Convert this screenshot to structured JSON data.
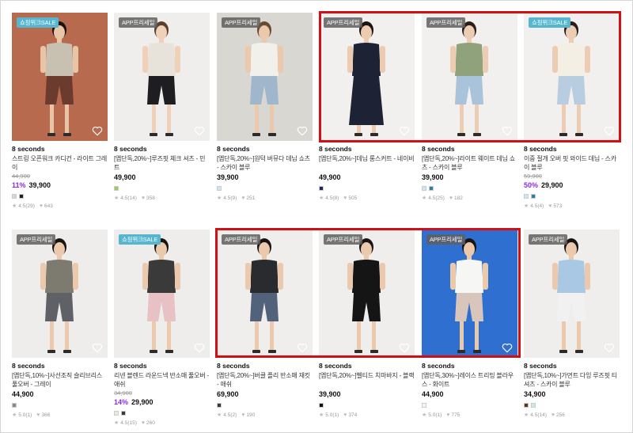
{
  "badges": {
    "sale": "쇼핑위크SALE",
    "app": "APP프리세일"
  },
  "products": [
    {
      "brand": "8 seconds",
      "name": "스트링 오픈워크 카디건 - 라이트 그레이",
      "orig": "44,900",
      "disc": "11%",
      "price": "39,900",
      "rating": "4.5(29)",
      "likes": "643",
      "badge": "sale",
      "swatches": [
        "#d8d5cf",
        "#222222"
      ]
    },
    {
      "brand": "8 seconds",
      "name": "[앱단독,20%~]루즈핏 체크 셔츠 - 민트",
      "orig": "",
      "disc": "",
      "price": "49,900",
      "rating": "4.5(14)",
      "likes": "358",
      "badge": "app",
      "swatches": [
        "#9acd5a"
      ]
    },
    {
      "brand": "8 seconds",
      "name": "[앱단독,20%~]원턱 버뮤다 데님 쇼츠 - 스카이 블루",
      "orig": "",
      "disc": "",
      "price": "39,900",
      "rating": "4.5(9)",
      "likes": "251",
      "badge": "app",
      "swatches": [
        "#cde6f3"
      ]
    },
    {
      "brand": "8 seconds",
      "name": "[앱단독,20%~]데님 롱스커트 - 네이비",
      "orig": "",
      "disc": "",
      "price": "49,900",
      "rating": "4.5(8)",
      "likes": "505",
      "badge": "app",
      "swatches": [
        "#1d2a55"
      ]
    },
    {
      "brand": "8 seconds",
      "name": "[앱단독,20%~]라이트 웨이트 데님 쇼츠 - 스카이 블루",
      "orig": "",
      "disc": "",
      "price": "39,900",
      "rating": "4.5(25)",
      "likes": "182",
      "badge": "app",
      "swatches": [
        "#cde6f3",
        "#2f7fa8"
      ]
    },
    {
      "brand": "8 seconds",
      "name": "이중 절개 오버 핏 와이드 데님 - 스카이 블루",
      "orig": "59,900",
      "disc": "50%",
      "price": "29,900",
      "rating": "4.5(4)",
      "likes": "573",
      "badge": "sale",
      "swatches": [
        "#cde6f3",
        "#2f7fa8"
      ]
    },
    {
      "brand": "8 seconds",
      "name": "[앱단독,10%~]사선조직 슬리브리스 풀오버 - 그레이",
      "orig": "",
      "disc": "",
      "price": "44,900",
      "rating": "5.0(1)",
      "likes": "366",
      "badge": "app",
      "swatches": [
        "#8a8a8a"
      ]
    },
    {
      "brand": "8 seconds",
      "name": "리넨 블렌드 라운드넥 반소매 풀오버 - 애쉬",
      "orig": "34,900",
      "disc": "14%",
      "price": "29,900",
      "rating": "4.5(15)",
      "likes": "260",
      "badge": "sale",
      "swatches": [
        "#ece9da",
        "#3a3a3a"
      ]
    },
    {
      "brand": "8 seconds",
      "name": "[앱단독,20%~]버클 플리 반소매 재킷 - 애쉬",
      "orig": "",
      "disc": "",
      "price": "69,900",
      "rating": "4.5(2)",
      "likes": "190",
      "badge": "app",
      "swatches": [
        "#3a3a3a"
      ]
    },
    {
      "brand": "8 seconds",
      "name": "[앱단독,20%~]벨티드 치마바지 - 블랙",
      "orig": "",
      "disc": "",
      "price": "39,900",
      "rating": "5.0(1)",
      "likes": "374",
      "badge": "app",
      "swatches": [
        "#111111"
      ]
    },
    {
      "brand": "8 seconds",
      "name": "[앱단독,30%~]레이스 트리밍 블라우스 - 화이트",
      "orig": "",
      "disc": "",
      "price": "44,900",
      "rating": "5.0(1)",
      "likes": "775",
      "badge": "app",
      "swatches": [
        "#f4f4f4"
      ]
    },
    {
      "brand": "8 seconds",
      "name": "[앱단독,10%~]가먼트 다잉 루즈핏 티셔츠 - 스카이 블루",
      "orig": "",
      "disc": "",
      "price": "34,900",
      "rating": "4.5(14)",
      "likes": "256",
      "badge": "app",
      "swatches": [
        "#6a2d1e",
        "#cde6f3"
      ]
    }
  ],
  "colors": {
    "discount": "#8a2be2",
    "highlight": "#d01015",
    "sale_badge": "#56b6cf",
    "app_badge": "#5f5f5f"
  },
  "icons": {
    "wishlist": "heart-outline-icon",
    "rating": "star-icon",
    "likes": "heart-icon"
  }
}
